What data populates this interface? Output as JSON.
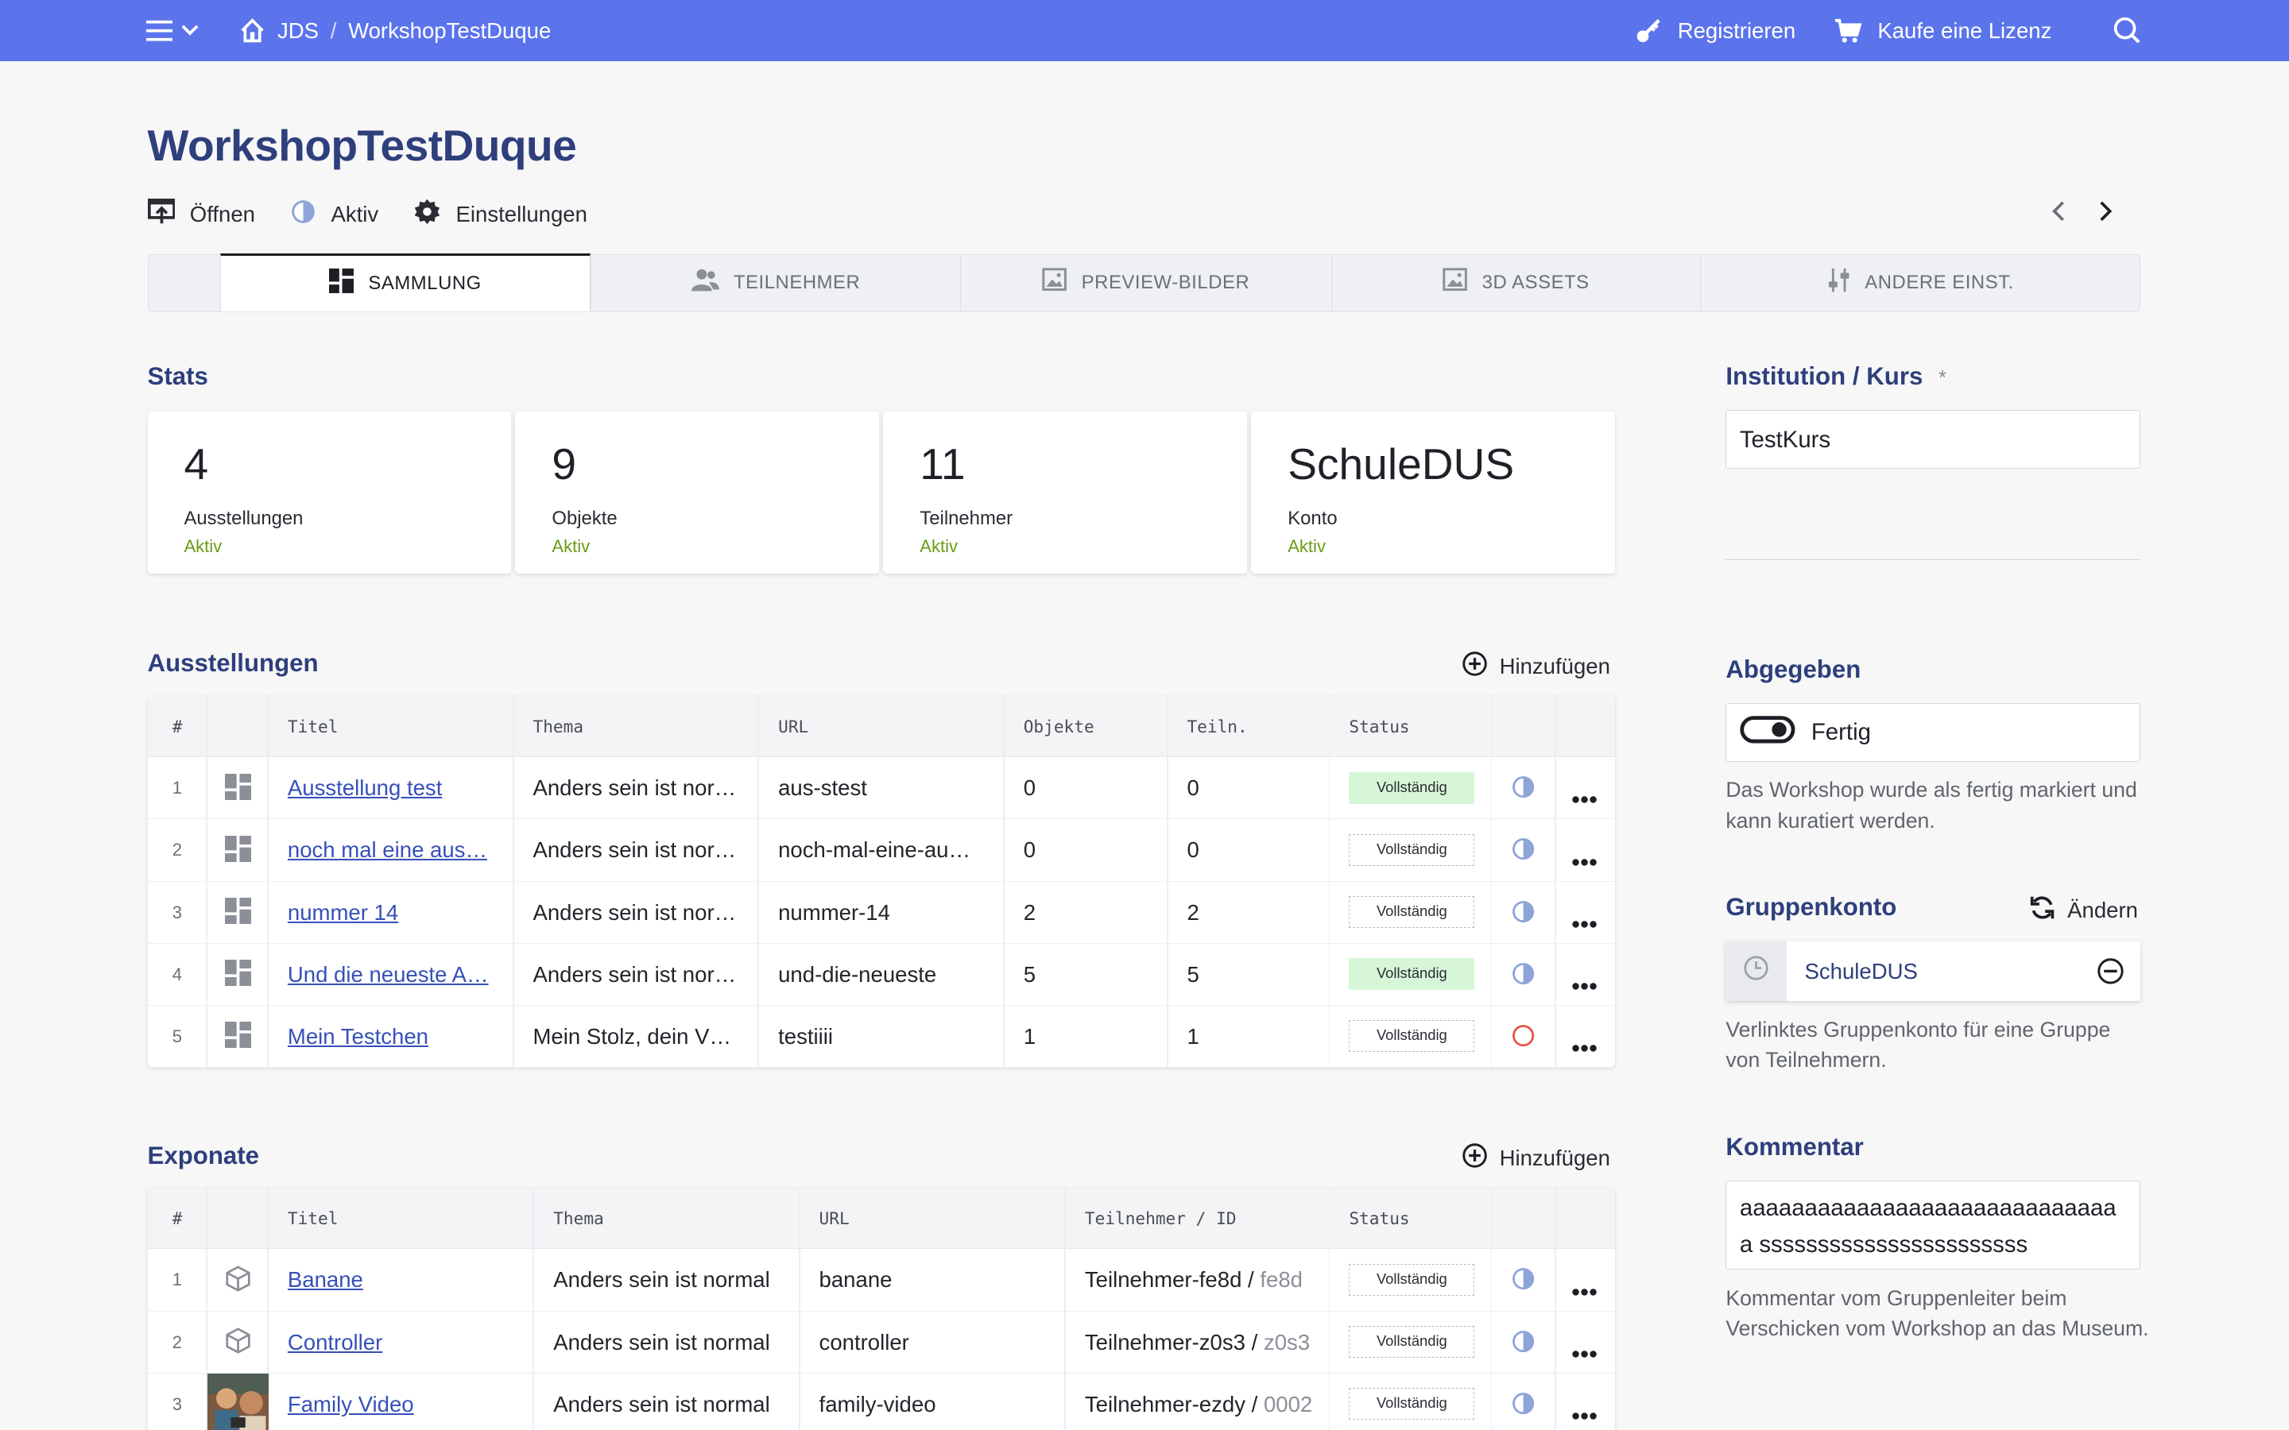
{
  "topbar": {
    "breadcrumb_root": "JDS",
    "breadcrumb_sep": "/",
    "breadcrumb_current": "WorkshopTestDuque",
    "register": "Registrieren",
    "license": "Kaufe eine Lizenz",
    "icons": [
      "menu-icon",
      "chevron-down-icon",
      "home-icon",
      "key-icon",
      "cart-icon",
      "search-icon"
    ]
  },
  "page": {
    "title": "WorkshopTestDuque",
    "actions": {
      "open": "Öffnen",
      "status": "Aktiv",
      "settings": "Einstellungen"
    }
  },
  "tabs": [
    "SAMMLUNG",
    "TEILNEHMER",
    "PREVIEW-BILDER",
    "3D ASSETS",
    "ANDERE EINST."
  ],
  "stats": {
    "heading": "Stats",
    "cards": [
      {
        "value": "4",
        "label": "Ausstellungen",
        "status": "Aktiv"
      },
      {
        "value": "9",
        "label": "Objekte",
        "status": "Aktiv"
      },
      {
        "value": "11",
        "label": "Teilnehmer",
        "status": "Aktiv"
      },
      {
        "value": "SchuleDUS",
        "label": "Konto",
        "status": "Aktiv"
      }
    ],
    "status_color": "#6a9a14"
  },
  "exhibitions": {
    "heading": "Ausstellungen",
    "add_label": "Hinzufügen",
    "columns": [
      "#",
      "Titel",
      "Thema",
      "URL",
      "Objekte",
      "Teiln.",
      "Status"
    ],
    "rows": [
      {
        "idx": "1",
        "title": "Ausstellung test",
        "theme": "Anders sein ist nor…",
        "url": "aus-stest",
        "objects": "0",
        "participants": "0",
        "status": "Vollständig",
        "complete": true,
        "state": "half"
      },
      {
        "idx": "2",
        "title": "noch mal eine aus…",
        "theme": "Anders sein ist nor…",
        "url": "noch-mal-eine-au…",
        "objects": "0",
        "participants": "0",
        "status": "Vollständig",
        "complete": false,
        "state": "half"
      },
      {
        "idx": "3",
        "title": "nummer 14",
        "theme": "Anders sein ist nor…",
        "url": "nummer-14",
        "objects": "2",
        "participants": "2",
        "status": "Vollständig",
        "complete": false,
        "state": "half"
      },
      {
        "idx": "4",
        "title": "Und die neueste A…",
        "theme": "Anders sein ist nor…",
        "url": "und-die-neueste",
        "objects": "5",
        "participants": "5",
        "status": "Vollständig",
        "complete": true,
        "state": "half"
      },
      {
        "idx": "5",
        "title": "Mein Testchen",
        "theme": "Mein Stolz, dein V…",
        "url": "testiiii",
        "objects": "1",
        "participants": "1",
        "status": "Vollständig",
        "complete": false,
        "state": "empty"
      }
    ]
  },
  "exhibits": {
    "heading": "Exponate",
    "add_label": "Hinzufügen",
    "columns": [
      "#",
      "Titel",
      "Thema",
      "URL",
      "Teilnehmer / ID",
      "Status"
    ],
    "rows": [
      {
        "idx": "1",
        "title": "Banane",
        "theme": "Anders sein ist normal",
        "url": "banane",
        "participant": "Teilnehmer-fe8d",
        "sep": " / ",
        "id": "fe8d",
        "status": "Vollständig",
        "thumb": "cube-icon"
      },
      {
        "idx": "2",
        "title": "Controller",
        "theme": "Anders sein ist normal",
        "url": "controller",
        "participant": "Teilnehmer-z0s3",
        "sep": " / ",
        "id": "z0s3",
        "status": "Vollständig",
        "thumb": "cube-icon"
      },
      {
        "idx": "3",
        "title": "Family Video",
        "theme": "Anders sein ist normal",
        "url": "family-video",
        "participant": "Teilnehmer-ezdy",
        "sep": " / ",
        "id": "0002",
        "status": "Vollständig",
        "thumb": "photo-thumbnail"
      }
    ]
  },
  "sidebar": {
    "institution_label": "Institution / Kurs",
    "required_mark": "*",
    "institution_value": "TestKurs",
    "submitted_label": "Abgegeben",
    "toggle_label": "Fertig",
    "submitted_help": "Das Workshop wurde als fertig markiert und kann kuratiert werden.",
    "group_label": "Gruppenkonto",
    "group_change": "Ändern",
    "group_account": "SchuleDUS",
    "group_help": "Verlinktes Gruppenkonto für eine Gruppe von Teilnehmern.",
    "comment_label": "Kommentar",
    "comment_value": "aaaaaaaaaaaaaaaaaaaaaaaaaaaaaa sssssssssssssssssssssss",
    "comment_help": "Kommentar vom Gruppenleiter beim Verschicken vom Workshop an das Museum."
  },
  "colors": {
    "topbar": "#5b74ec",
    "heading": "#2e3f7c",
    "link": "#3650b9",
    "badge_complete": "#d7f6d7"
  }
}
